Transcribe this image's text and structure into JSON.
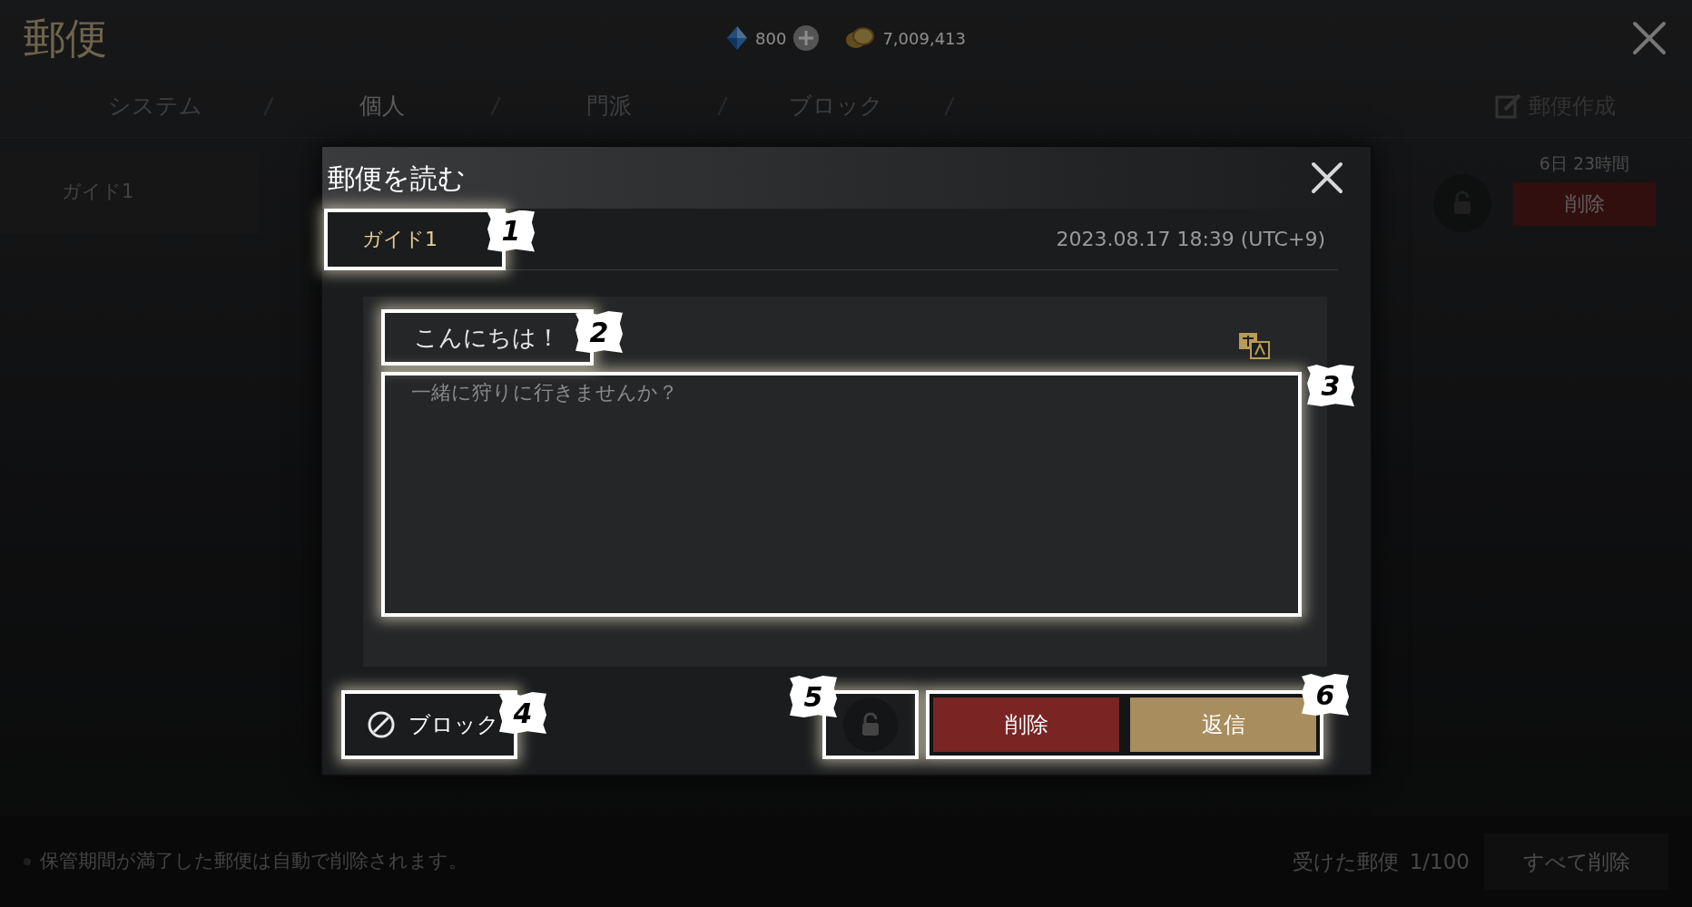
{
  "header": {
    "title": "郵便",
    "currencies": [
      {
        "kind": "gem",
        "amount": "800",
        "add_button": true
      },
      {
        "kind": "coin",
        "amount": "7,009,413",
        "add_button": false
      }
    ]
  },
  "tabs": [
    {
      "label": "システム",
      "selected": false
    },
    {
      "label": "個人",
      "selected": true
    },
    {
      "label": "門派",
      "selected": false
    },
    {
      "label": "ブロック",
      "selected": false
    }
  ],
  "compose_button": "郵便作成",
  "mail_list": [
    {
      "sender": "ガイド1",
      "time_left": "6日 23時間",
      "delete_label": "削除"
    }
  ],
  "footer": {
    "note": "保管期間が満了した郵便は自動で削除されます。",
    "count_label": "受けた郵便",
    "count": "1/100",
    "delete_all": "すべて削除"
  },
  "dialog": {
    "title": "郵便を読む",
    "sender": {
      "text": "ガイド1",
      "callout": "1"
    },
    "date": "2023.08.17 18:39 (UTC+9)",
    "subject": {
      "text": "こんにちは！",
      "callout": "2"
    },
    "body": {
      "text": "一緒に狩りに行きませんか？",
      "callout": "3"
    },
    "block_button": {
      "label": "ブロック",
      "callout": "4"
    },
    "lock_button": {
      "callout": "5"
    },
    "actions": {
      "callout": "6",
      "buttons": [
        {
          "kind": "delete",
          "label": "削除"
        },
        {
          "kind": "reply",
          "label": "返信"
        }
      ]
    }
  }
}
